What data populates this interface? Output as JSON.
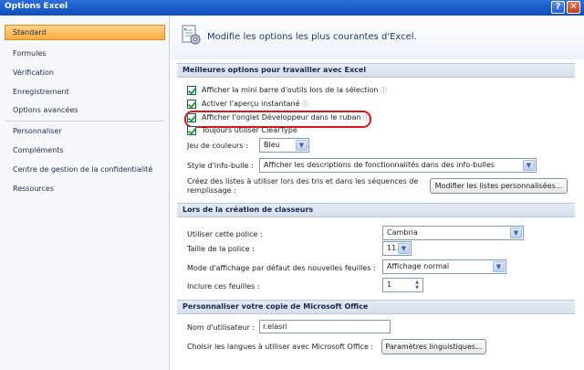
{
  "window": {
    "title": "Options Excel",
    "help_glyph": "?",
    "close_glyph": "✕"
  },
  "sidebar": {
    "items": [
      {
        "label": "Standard",
        "active": true
      },
      {
        "label": "Formules"
      },
      {
        "label": "Vérification"
      },
      {
        "label": "Enregistrement"
      },
      {
        "label": "Options avancées"
      },
      {
        "label": "Personnaliser"
      },
      {
        "label": "Compléments"
      },
      {
        "label": "Centre de gestion de la confidentialité"
      },
      {
        "label": "Ressources"
      }
    ]
  },
  "header": {
    "text": "Modifie les options les plus courantes d'Excel."
  },
  "sections": {
    "best_options": "Meilleures options pour travailler avec Excel",
    "new_workbooks": "Lors de la création de classeurs",
    "personalize": "Personnaliser votre copie de Microsoft Office"
  },
  "checkboxes": [
    {
      "label": "Afficher la mini barre d'outils lors de la sélection",
      "checked": true,
      "info": true
    },
    {
      "label": "Activer l'aperçu instantané",
      "checked": true,
      "info": true
    },
    {
      "label": "Afficher l'onglet Développeur dans le ruban",
      "checked": true,
      "info": true
    },
    {
      "label": "Toujours utiliser ClearType",
      "checked": true,
      "info": false
    }
  ],
  "color_scheme": {
    "label": "Jeu de couleurs :",
    "value": "Bleu"
  },
  "tooltip_style": {
    "label": "Style d'info-bulle :",
    "value": "Afficher les descriptions de fonctionnalités dans des info-bulles"
  },
  "custom_lists": {
    "text_line1": "Créez des listes à utiliser lors des tris et dans les séquences de",
    "text_line2": "remplissage :",
    "button": "Modifier les listes personnalisées..."
  },
  "font": {
    "label": "Utiliser cette police :",
    "value": "Cambria"
  },
  "font_size": {
    "label": "Taille de la police :",
    "value": "11"
  },
  "default_view": {
    "label": "Mode d'affichage par défaut des nouvelles feuilles :",
    "value": "Affichage normal"
  },
  "sheet_count": {
    "label": "Inclure ces feuilles :",
    "value": "1"
  },
  "username": {
    "label": "Nom d'utilisateur :",
    "value": "r.elasri"
  },
  "languages": {
    "label": "Choisir les langues à utiliser avec Microsoft Office :",
    "button": "Paramètres linguistiques..."
  },
  "icons": {
    "info": "info-icon",
    "dropdown": "chevron-down-icon",
    "spin": "spin-arrows-icon",
    "header": "options-icon"
  },
  "colors": {
    "accent": "#f9ab3e",
    "highlight_ring": "#e01515",
    "title_bar": "#0d4fbf"
  }
}
